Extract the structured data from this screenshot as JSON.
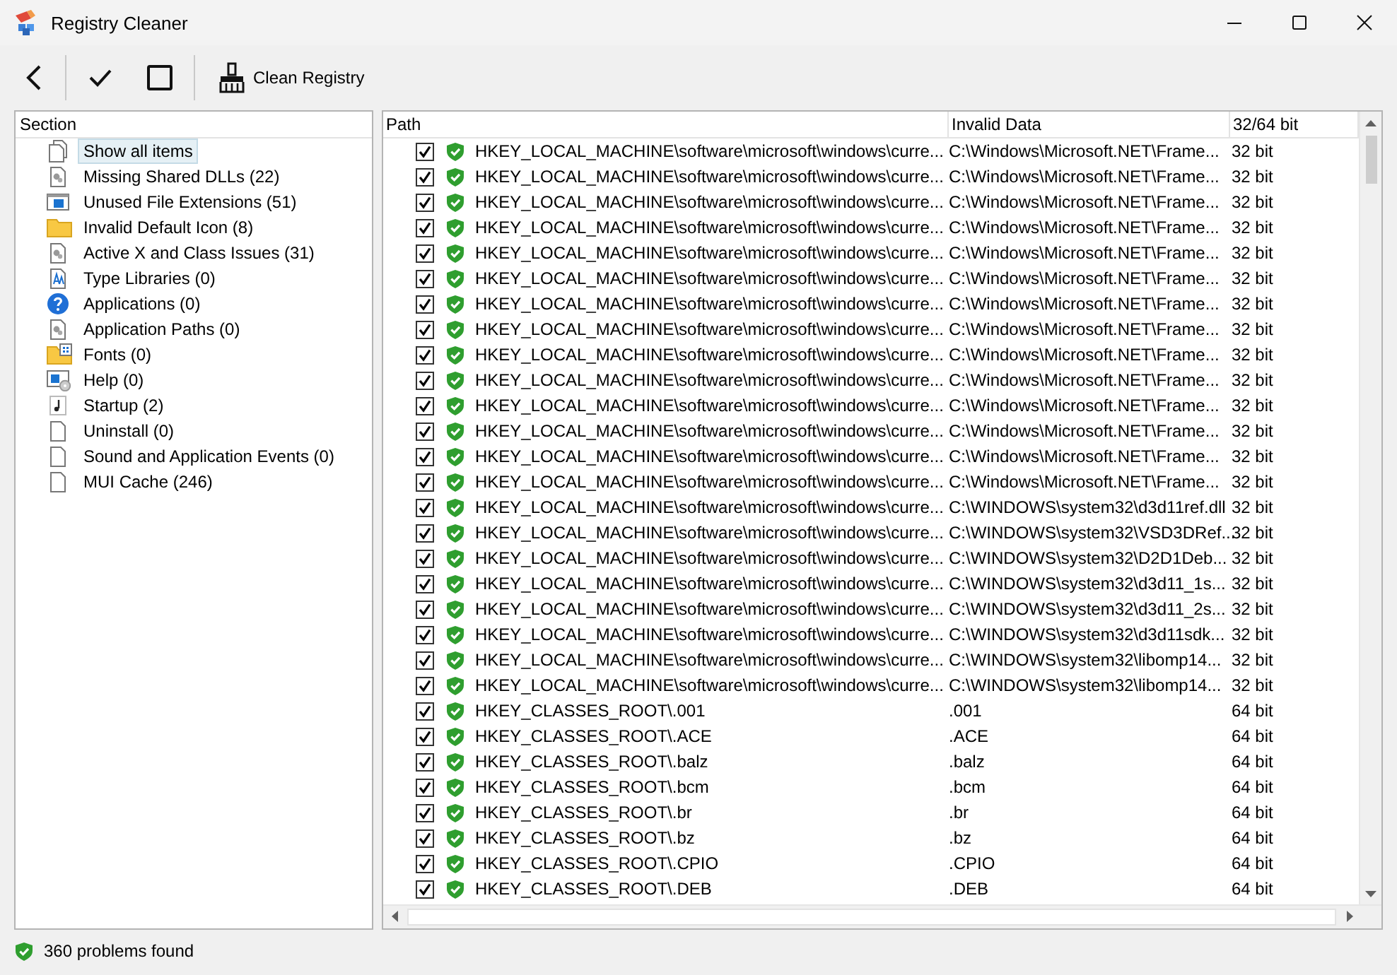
{
  "window": {
    "title": "Registry Cleaner"
  },
  "toolbar": {
    "clean_label": "Clean Registry"
  },
  "sections": {
    "header": "Section",
    "items": [
      {
        "label": "Show all items",
        "kind": "pages",
        "selected": true
      },
      {
        "label": "Missing Shared DLLs (22)",
        "kind": "gear",
        "selected": false
      },
      {
        "label": "Unused File Extensions (51)",
        "kind": "window",
        "selected": false
      },
      {
        "label": "Invalid Default Icon (8)",
        "kind": "folder",
        "selected": false
      },
      {
        "label": "Active X and Class Issues (31)",
        "kind": "gear",
        "selected": false
      },
      {
        "label": "Type Libraries (0)",
        "kind": "type",
        "selected": false
      },
      {
        "label": "Applications (0)",
        "kind": "question",
        "selected": false
      },
      {
        "label": "Application Paths (0)",
        "kind": "gear",
        "selected": false
      },
      {
        "label": "Fonts (0)",
        "kind": "fontfolder",
        "selected": false
      },
      {
        "label": "Help (0)",
        "kind": "disc",
        "selected": false
      },
      {
        "label": "Startup (2)",
        "kind": "note",
        "selected": false
      },
      {
        "label": "Uninstall (0)",
        "kind": "blank",
        "selected": false
      },
      {
        "label": "Sound and Application Events (0)",
        "kind": "blank",
        "selected": false
      },
      {
        "label": "MUI Cache (246)",
        "kind": "blank",
        "selected": false
      }
    ]
  },
  "results": {
    "columns": [
      "Path",
      "Invalid Data",
      "32/64 bit"
    ],
    "rows": [
      {
        "checked": true,
        "path": "HKEY_LOCAL_MACHINE\\software\\microsoft\\windows\\curre...",
        "data": "C:\\Windows\\Microsoft.NET\\Frame...",
        "bits": "32 bit"
      },
      {
        "checked": true,
        "path": "HKEY_LOCAL_MACHINE\\software\\microsoft\\windows\\curre...",
        "data": "C:\\Windows\\Microsoft.NET\\Frame...",
        "bits": "32 bit"
      },
      {
        "checked": true,
        "path": "HKEY_LOCAL_MACHINE\\software\\microsoft\\windows\\curre...",
        "data": "C:\\Windows\\Microsoft.NET\\Frame...",
        "bits": "32 bit"
      },
      {
        "checked": true,
        "path": "HKEY_LOCAL_MACHINE\\software\\microsoft\\windows\\curre...",
        "data": "C:\\Windows\\Microsoft.NET\\Frame...",
        "bits": "32 bit"
      },
      {
        "checked": true,
        "path": "HKEY_LOCAL_MACHINE\\software\\microsoft\\windows\\curre...",
        "data": "C:\\Windows\\Microsoft.NET\\Frame...",
        "bits": "32 bit"
      },
      {
        "checked": true,
        "path": "HKEY_LOCAL_MACHINE\\software\\microsoft\\windows\\curre...",
        "data": "C:\\Windows\\Microsoft.NET\\Frame...",
        "bits": "32 bit"
      },
      {
        "checked": true,
        "path": "HKEY_LOCAL_MACHINE\\software\\microsoft\\windows\\curre...",
        "data": "C:\\Windows\\Microsoft.NET\\Frame...",
        "bits": "32 bit"
      },
      {
        "checked": true,
        "path": "HKEY_LOCAL_MACHINE\\software\\microsoft\\windows\\curre...",
        "data": "C:\\Windows\\Microsoft.NET\\Frame...",
        "bits": "32 bit"
      },
      {
        "checked": true,
        "path": "HKEY_LOCAL_MACHINE\\software\\microsoft\\windows\\curre...",
        "data": "C:\\Windows\\Microsoft.NET\\Frame...",
        "bits": "32 bit"
      },
      {
        "checked": true,
        "path": "HKEY_LOCAL_MACHINE\\software\\microsoft\\windows\\curre...",
        "data": "C:\\Windows\\Microsoft.NET\\Frame...",
        "bits": "32 bit"
      },
      {
        "checked": true,
        "path": "HKEY_LOCAL_MACHINE\\software\\microsoft\\windows\\curre...",
        "data": "C:\\Windows\\Microsoft.NET\\Frame...",
        "bits": "32 bit"
      },
      {
        "checked": true,
        "path": "HKEY_LOCAL_MACHINE\\software\\microsoft\\windows\\curre...",
        "data": "C:\\Windows\\Microsoft.NET\\Frame...",
        "bits": "32 bit"
      },
      {
        "checked": true,
        "path": "HKEY_LOCAL_MACHINE\\software\\microsoft\\windows\\curre...",
        "data": "C:\\Windows\\Microsoft.NET\\Frame...",
        "bits": "32 bit"
      },
      {
        "checked": true,
        "path": "HKEY_LOCAL_MACHINE\\software\\microsoft\\windows\\curre...",
        "data": "C:\\Windows\\Microsoft.NET\\Frame...",
        "bits": "32 bit"
      },
      {
        "checked": true,
        "path": "HKEY_LOCAL_MACHINE\\software\\microsoft\\windows\\curre...",
        "data": "C:\\WINDOWS\\system32\\d3d11ref.dll",
        "bits": "32 bit"
      },
      {
        "checked": true,
        "path": "HKEY_LOCAL_MACHINE\\software\\microsoft\\windows\\curre...",
        "data": "C:\\WINDOWS\\system32\\VSD3DRef...",
        "bits": "32 bit"
      },
      {
        "checked": true,
        "path": "HKEY_LOCAL_MACHINE\\software\\microsoft\\windows\\curre...",
        "data": "C:\\WINDOWS\\system32\\D2D1Deb...",
        "bits": "32 bit"
      },
      {
        "checked": true,
        "path": "HKEY_LOCAL_MACHINE\\software\\microsoft\\windows\\curre...",
        "data": "C:\\WINDOWS\\system32\\d3d11_1s...",
        "bits": "32 bit"
      },
      {
        "checked": true,
        "path": "HKEY_LOCAL_MACHINE\\software\\microsoft\\windows\\curre...",
        "data": "C:\\WINDOWS\\system32\\d3d11_2s...",
        "bits": "32 bit"
      },
      {
        "checked": true,
        "path": "HKEY_LOCAL_MACHINE\\software\\microsoft\\windows\\curre...",
        "data": "C:\\WINDOWS\\system32\\d3d11sdk...",
        "bits": "32 bit"
      },
      {
        "checked": true,
        "path": "HKEY_LOCAL_MACHINE\\software\\microsoft\\windows\\curre...",
        "data": "C:\\WINDOWS\\system32\\libomp14...",
        "bits": "32 bit"
      },
      {
        "checked": true,
        "path": "HKEY_LOCAL_MACHINE\\software\\microsoft\\windows\\curre...",
        "data": "C:\\WINDOWS\\system32\\libomp14...",
        "bits": "32 bit"
      },
      {
        "checked": true,
        "path": "HKEY_CLASSES_ROOT\\.001",
        "data": ".001",
        "bits": "64 bit"
      },
      {
        "checked": true,
        "path": "HKEY_CLASSES_ROOT\\.ACE",
        "data": ".ACE",
        "bits": "64 bit"
      },
      {
        "checked": true,
        "path": "HKEY_CLASSES_ROOT\\.balz",
        "data": ".balz",
        "bits": "64 bit"
      },
      {
        "checked": true,
        "path": "HKEY_CLASSES_ROOT\\.bcm",
        "data": ".bcm",
        "bits": "64 bit"
      },
      {
        "checked": true,
        "path": "HKEY_CLASSES_ROOT\\.br",
        "data": ".br",
        "bits": "64 bit"
      },
      {
        "checked": true,
        "path": "HKEY_CLASSES_ROOT\\.bz",
        "data": ".bz",
        "bits": "64 bit"
      },
      {
        "checked": true,
        "path": "HKEY_CLASSES_ROOT\\.CPIO",
        "data": ".CPIO",
        "bits": "64 bit"
      },
      {
        "checked": true,
        "path": "HKEY_CLASSES_ROOT\\.DEB",
        "data": ".DEB",
        "bits": "64 bit"
      }
    ]
  },
  "status_bar": {
    "text": "360 problems found"
  }
}
